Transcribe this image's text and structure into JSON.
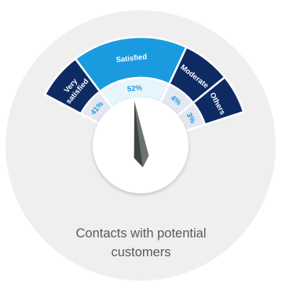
{
  "caption": "Contacts with potential customers",
  "colors": {
    "outer_disc": "#efefef",
    "outer_band_dark": "#0d2a63",
    "outer_band_highlight": "#1a9be0",
    "inner_band_light": "#e3e7f0",
    "inner_band_highlight": "#e6f5fc",
    "outer_label": "#ffffff",
    "inner_label": "#1a9be0",
    "needle_dark": "#3d4540",
    "needle_light": "#6c726e",
    "hub": "#ffffff"
  },
  "chart_data": {
    "type": "gauge",
    "title": "",
    "segments": [
      {
        "category": "Very satisfied",
        "value": 41,
        "value_label": "41%",
        "highlight": false
      },
      {
        "category": "Satisfied",
        "value": 52,
        "value_label": "52%",
        "highlight": true
      },
      {
        "category": "Moderate",
        "value": 4,
        "value_label": "4%",
        "highlight": false
      },
      {
        "category": "Others",
        "value": 3,
        "value_label": "3%",
        "highlight": false
      }
    ],
    "needle_points_to": "Satisfied"
  }
}
